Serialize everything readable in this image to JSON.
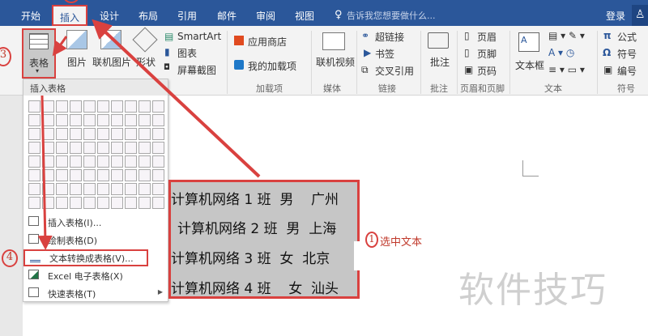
{
  "tabs": [
    "开始",
    "插入",
    "设计",
    "布局",
    "引用",
    "邮件",
    "审阅",
    "视图"
  ],
  "search_placeholder": "告诉我您想要做什么...",
  "login": "登录",
  "ribbon": {
    "table": "表格",
    "picture": "图片",
    "online_picture": "联机图片",
    "shapes": "形状",
    "smartart": "SmartArt",
    "chart": "图表",
    "screenshot": "屏幕截图",
    "store": "应用商店",
    "my_addins": "我的加载项",
    "addins_group": "加载项",
    "online_video": "联机视频",
    "media_group": "媒体",
    "hyperlink": "超链接",
    "bookmark": "书签",
    "crossref": "交叉引用",
    "links_group": "链接",
    "comment": "批注",
    "comment_group": "批注",
    "header": "页眉",
    "footer": "页脚",
    "page_number": "页码",
    "hf_group": "页眉和页脚",
    "textbox": "文本框",
    "text_group": "文本",
    "equation": "公式",
    "symbol": "符号",
    "numbering": "编号",
    "symbol_group": "符号"
  },
  "dropdown": {
    "title": "插入表格",
    "items": [
      "插入表格(I)...",
      "绘制表格(D)",
      "文本转换成表格(V)...",
      "Excel 电子表格(X)",
      "快速表格(T)"
    ]
  },
  "doc_lines": [
    "计算机网络 1 班  男    广州",
    "计算机网络 2 班  男  上海",
    "计算机网络 3 班  女  北京",
    "计算机网络 4 班    女  汕头"
  ],
  "annotations": {
    "step1": "1",
    "step1_text": "选中文本",
    "step3": "3",
    "step4": "4"
  },
  "watermark": "软件技巧",
  "colors": {
    "accent": "#2b579a",
    "annotation": "#d9413f"
  }
}
